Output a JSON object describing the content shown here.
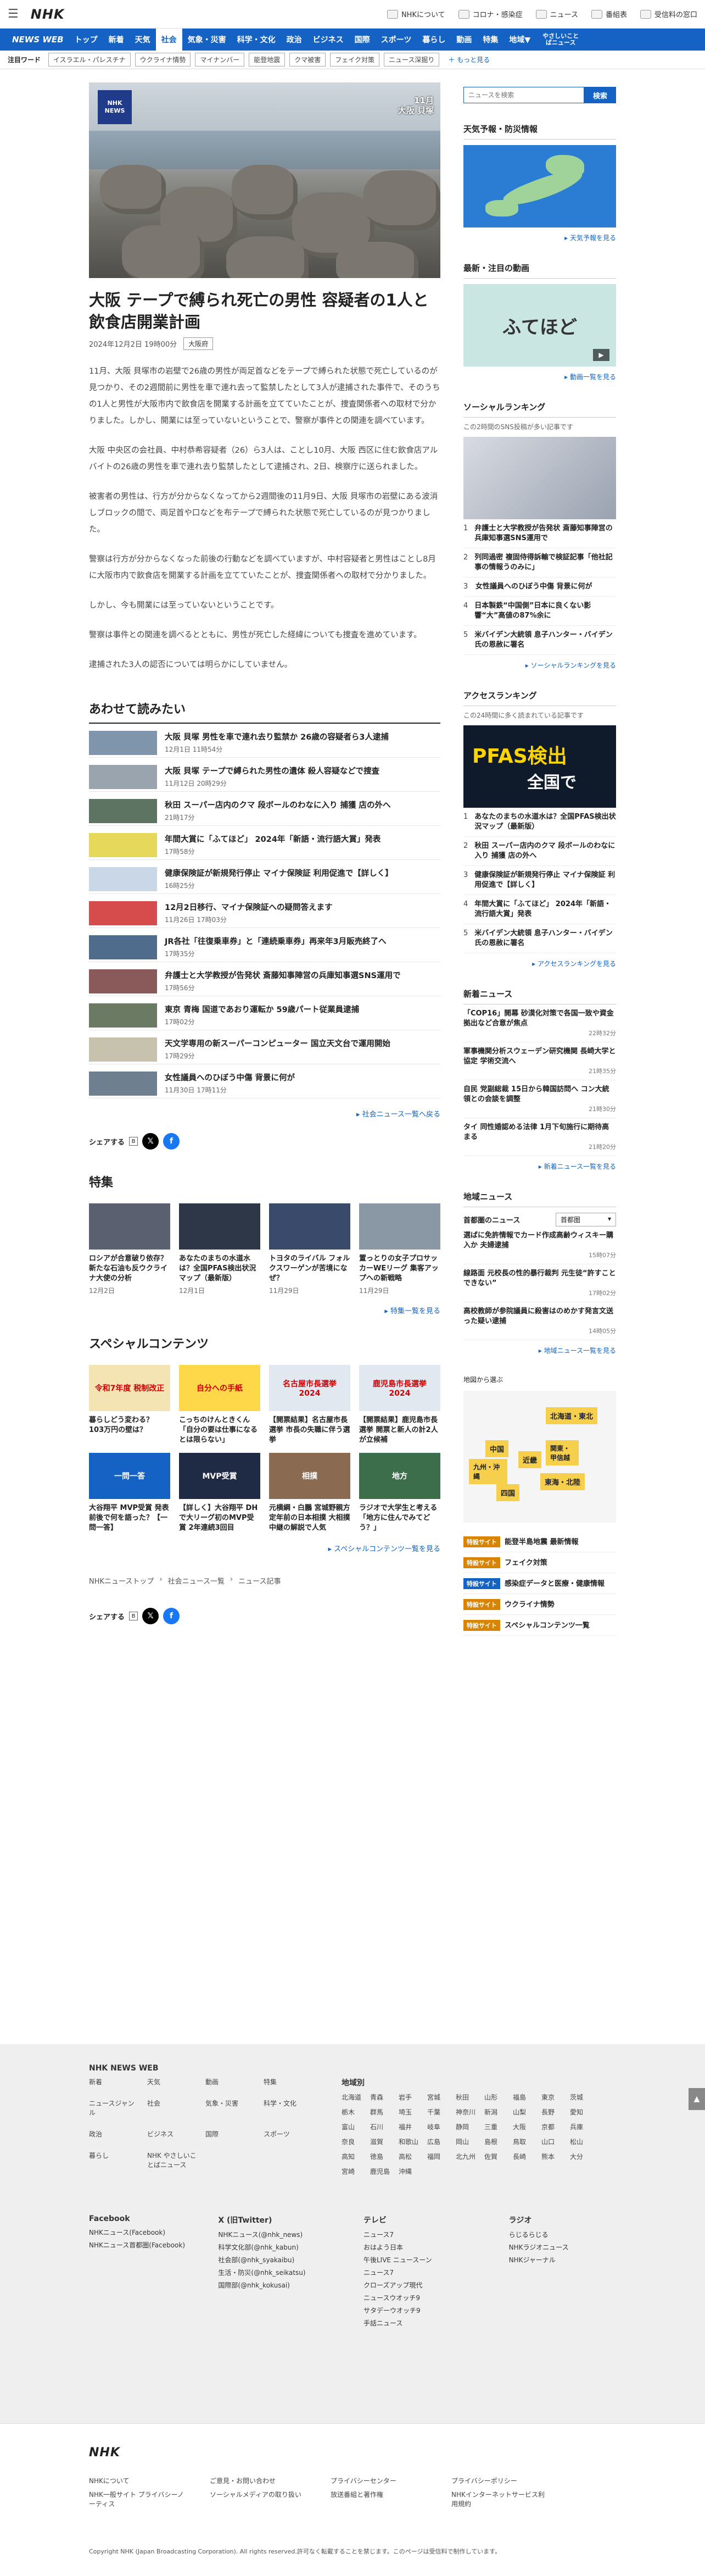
{
  "header": {
    "logo": "NHK",
    "links": [
      "NHKについて",
      "コロナ・感染症",
      "ニュース",
      "番組表",
      "受信料の窓口"
    ]
  },
  "nav": {
    "brand": "NEWS WEB",
    "items": [
      "トップ",
      "新着",
      "天気",
      "社会",
      "気象・災害",
      "科学・文化",
      "政治",
      "ビジネス",
      "国際",
      "スポーツ",
      "暮らし",
      "動画",
      "特集",
      "地域▼"
    ],
    "easy": "やさしいことばニュース"
  },
  "trend": {
    "label": "注目ワード",
    "chips": [
      "イスラエル・パレスチナ",
      "ウクライナ情勢",
      "マイナンバー",
      "能登地震",
      "クマ被害",
      "フェイク対策",
      "ニュース深掘り"
    ],
    "more": "＋ もっと見る"
  },
  "hero": {
    "badge_l1": "NHK",
    "badge_l2": "NEWS",
    "caption_l1": "11月",
    "caption_l2": "大阪 貝塚"
  },
  "article": {
    "title": "大阪 テープで縛られ死亡の男性 容疑者の1人と飲食店開業計画",
    "date": "2024年12月2日 19時00分",
    "tag": "大阪府",
    "paragraphs": [
      "11月、大阪 貝塚市の岩壁で26歳の男性が両足首などをテープで縛られた状態で死亡しているのが見つかり、その2週間前に男性を車で連れ去って監禁したとして3人が逮捕された事件で、そのうちの1人と男性が大阪市内で飲食店を開業する計画を立てていたことが、捜査関係者への取材で分かりました。しかし、開業には至っていないということで、警察が事件との関連を調べています。",
      "大阪 中央区の会社員、中村恭希容疑者（26）ら3人は、ことし10月、大阪 西区に住む飲食店アルバイトの26歳の男性を車で連れ去り監禁したとして逮捕され、2日、検察庁に送られました。",
      "被害者の男性は、行方が分からなくなってから2週間後の11月9日、大阪 貝塚市の岩壁にある波消しブロックの間で、両足首や口などを布テープで縛られた状態で死亡しているのが見つかりました。",
      "警察は行方が分からなくなった前後の行動などを調べていますが、中村容疑者と男性はことし8月に大阪市内で飲食店を開業する計画を立てていたことが、捜査関係者への取材で分かりました。",
      "しかし、今も開業には至っていないということです。",
      "警察は事件との関連を調べるとともに、男性が死亡した経緯についても捜査を進めています。",
      "逮捕された3人の認否については明らかにしていません。"
    ]
  },
  "related": {
    "title": "あわせて読みたい",
    "items": [
      {
        "title": "大阪 貝塚 男性を車で連れ去り監禁か 26歳の容疑者ら3人逮捕",
        "date": "12月1日 11時54分"
      },
      {
        "title": "大阪 貝塚 テープで縛られた男性の遺体 殺人容疑などで捜査",
        "date": "11月12日 20時29分"
      },
      {
        "title": "秋田 スーパー店内のクマ 段ボールのわなに入り 捕獲 店の外へ",
        "date": "21時17分"
      },
      {
        "title": "年間大賞に「ふてほど」 2024年「新語・流行語大賞」発表",
        "date": "17時58分"
      },
      {
        "title": "健康保険証が新規発行停止 マイナ保険証 利用促進で【詳しく】",
        "date": "16時25分"
      },
      {
        "title": "12月2日移行、マイナ保険証への疑問答えます",
        "date": "11月26日 17時03分"
      },
      {
        "title": "JR各社「往復乗車券」と「連続乗車券」再来年3月販売終了へ",
        "date": "17時35分"
      },
      {
        "title": "弁護士と大学教授が告発状 斎藤知事陣営の兵庫知事選SNS運用で",
        "date": "17時56分"
      },
      {
        "title": "東京 青梅 国道であおり運転か 59歳パート従業員逮捕",
        "date": "17時02分"
      },
      {
        "title": "天文学専用の新スーパーコンピューター 国立天文台で運用開始",
        "date": "17時29分"
      },
      {
        "title": "女性議員へのひぼう中傷 背景に何が",
        "date": "11月30日 17時11分"
      }
    ],
    "more": "▸ 社会ニュース一覧へ戻る"
  },
  "share": {
    "label": "シェアする"
  },
  "features": {
    "title": "特集",
    "items": [
      {
        "title": "ロシアが合意破り依存？新たな石油も反ウクライナ大使の分析",
        "date": "12月2日"
      },
      {
        "title": "あなたのまちの水道水は？全国PFAS検出状況マップ（最新版）",
        "date": "12月1日"
      },
      {
        "title": "トヨタのライバル フォルクスワーゲンが苦境になぜ？",
        "date": "11月29日"
      },
      {
        "title": "置っとりの女子プロサッカーWEリーグ 集客アップへの新戦略",
        "date": "11月29日"
      }
    ],
    "more": "▸ 特集一覧を見る"
  },
  "special": {
    "title": "スペシャルコンテンツ",
    "items": [
      {
        "title": "暮らしどう変わる？ 103万円の壁は？",
        "img": "令和7年度 税制改正"
      },
      {
        "title": "こっちのけんときくん「自分の要は仕事になるとは限らない」",
        "img": "自分への手紙"
      },
      {
        "title": "【開票結果】名古屋市長選挙 市長の失職に伴う選挙",
        "img": "名古屋市長選挙 2024"
      },
      {
        "title": "【開票結果】鹿児島市長選挙 開票と新人の計2人が立候補",
        "img": "鹿児島市長選挙 2024"
      },
      {
        "title": "大谷翔平 MVP受賞 発表前後で何を語った？【一問一答】",
        "img": "一問一答"
      },
      {
        "title": "【詳しく】大谷翔平 DHで大リーグ初のMVP受賞 2年連続3回目",
        "img": "MVP受賞"
      },
      {
        "title": "元横綱・白鵬 宮城野親方 定年前の日本相撲 大相撲中継の解説で人気",
        "img": "相撲"
      },
      {
        "title": "ラジオで大学生と考える「地方に住んでみてどう？」",
        "img": "地方"
      }
    ],
    "more": "▸ スペシャルコンテンツ一覧を見る"
  },
  "breadcrumbs": [
    "NHKニューストップ",
    "社会ニュース一覧",
    "ニュース記事"
  ],
  "side": {
    "search": {
      "placeholder": "ニュースを検索",
      "button": "検索"
    },
    "weather": {
      "title": "天気予報・防災情報",
      "more": "▸ 天気予報を見る"
    },
    "video": {
      "title": "最新・注目の動画",
      "img": "ふてほど",
      "more": "▸ 動画一覧を見る"
    },
    "social": {
      "title": "ソーシャルランキング",
      "sub": "この2時間のSNS投稿が多い記事です",
      "items": [
        "弁護士と大学教授が告発状 斎藤知事陣営の兵庫知事選SNS運用で",
        "列同過密 複固侍得訴輸で検証記事「他社記事の情報うのみに」",
        "女性議員へのひぼう中傷 背景に何が",
        "日本製鉄“中国側”日本に良くない影響“大”高値の87%余に",
        "米バイデン大統領 息子ハンター・バイデン氏の恩赦に署名"
      ],
      "more": "▸ ソーシャルランキングを見る"
    },
    "access": {
      "title": "アクセスランキング",
      "sub": "この24時間に多く読まれている記事です",
      "img_l1": "PFAS検出",
      "img_l2": "全国で",
      "items": [
        "あなたのまちの水道水は？全国PFAS検出状況マップ（最新版）",
        "秋田 スーパー店内のクマ 段ボールのわなに入り 捕獲 店の外へ",
        "健康保険証が新規発行停止 マイナ保険証 利用促進で【詳しく】",
        "年間大賞に「ふてほど」 2024年「新語・流行語大賞」発表",
        "米バイデン大統領 息子ハンター・バイデン氏の恩赦に署名"
      ],
      "more": "▸ アクセスランキングを見る"
    },
    "newest": {
      "title": "新着ニュース",
      "items": [
        {
          "t": "「COP16」開幕 砂漠化対策で各国一致や資金拠出など合意が焦点",
          "d": "22時32分"
        },
        {
          "t": "軍事機関分析スウェーデン研究機関 長崎大学と協定 学術交流へ",
          "d": "21時35分"
        },
        {
          "t": "自民 党副総裁 15日から韓国訪問へ コン大統領との会談を調整",
          "d": "21時30分"
        },
        {
          "t": "タイ 同性婚認める法律 1月下旬施行に期待高まる",
          "d": "21時20分"
        }
      ],
      "more": "▸ 新着ニュース一覧を見る"
    },
    "local": {
      "title": "地域ニュース",
      "region_label": "首都圏のニュース",
      "select": "首都圏",
      "items": [
        {
          "t": "選ばに免許情報でカード作成高齢ウィスキー購入か 夫婦逮捕",
          "d": "15時07分"
        },
        {
          "t": "線路面 元校長の性的暴行裁判 元生徒“許すことできない”",
          "d": "17時02分"
        },
        {
          "t": "高校教師が参院議員に殺害はのめかす発言文送った疑い逮捕",
          "d": "14時05分"
        }
      ],
      "more": "▸ 地域ニュース一覧を見る"
    },
    "regionmap": {
      "title": "地図から選ぶ",
      "areas": [
        "北海道・東北",
        "関東・甲信越",
        "東海・北陸",
        "近畿",
        "中国",
        "四国",
        "九州・沖縄"
      ]
    },
    "links": [
      {
        "badge": "特設サイト",
        "text": "能登半島地震 最新情報"
      },
      {
        "badge": "特設サイト",
        "text": "フェイク対策"
      },
      {
        "badge": "特設サイト",
        "text": "感染症データと医療・健康情報"
      },
      {
        "badge": "特設サイト",
        "text": "ウクライナ情勢"
      },
      {
        "badge": "特設サイト",
        "text": "スペシャルコンテンツ一覧"
      }
    ]
  },
  "footer": {
    "brand": "NHK NEWS WEB",
    "col1": [
      "新着",
      "天気",
      "動画",
      "特集",
      "ニュースジャンル",
      "社会",
      "気象・災害",
      "科学・文化",
      "政治",
      "ビジネス",
      "国際",
      "スポーツ",
      "暮らし",
      "NHK やさしいことばニュース"
    ],
    "region_title": "地域別",
    "regions": [
      "北海道",
      "青森",
      "岩手",
      "宮城",
      "秋田",
      "山形",
      "福島",
      "東京",
      "茨城",
      "栃木",
      "群馬",
      "埼玉",
      "千葉",
      "神奈川",
      "新潟",
      "山梨",
      "長野",
      "愛知",
      "富山",
      "石川",
      "福井",
      "岐阜",
      "静岡",
      "三重",
      "大阪",
      "京都",
      "兵庫",
      "奈良",
      "滋賀",
      "和歌山",
      "広島",
      "岡山",
      "島根",
      "鳥取",
      "山口",
      "松山",
      "高知",
      "徳島",
      "高松",
      "福岡",
      "北九州",
      "佐賀",
      "長崎",
      "熊本",
      "大分",
      "宮崎",
      "鹿児島",
      "沖縄"
    ],
    "sns_title": "Facebook",
    "sns_items": [
      "NHKニュース(Facebook)",
      "NHKニュース首都圏(Facebook)"
    ],
    "x_title": "X (旧Twitter)",
    "x_items": [
      "NHKニュース(@nhk_news)",
      "科学文化部(@nhk_kabun)",
      "社会部(@nhk_syakaibu)",
      "生活・防災(@nhk_seikatsu)",
      "国際部(@nhk_kokusai)"
    ],
    "tv_title": "テレビ",
    "tv_items": [
      "ニュース7",
      "おはよう日本",
      "午後LIVE ニュースーン",
      "ニュース7",
      "クローズアップ現代",
      "ニュースウオッチ9",
      "サタデーウオッチ9",
      "手話ニュース"
    ],
    "radio_title": "ラジオ",
    "radio_items": [
      "らじるらじる",
      "NHKラジオニュース",
      "NHKジャーナル"
    ],
    "bottom_links": [
      "NHKについて",
      "ご意見・お問い合わせ",
      "プライバシーセンター",
      "プライバシーポリシー",
      "NHK一般サイト プライバシーノーティス",
      "ソーシャルメディアの取り扱い",
      "放送番組と著作権",
      "NHKインターネットサービス利用規約"
    ],
    "copyright": "Copyright NHK (Japan Broadcasting Corporation). All rights reserved.許可なく転載することを禁じます。このページは受信料で制作しています。"
  }
}
